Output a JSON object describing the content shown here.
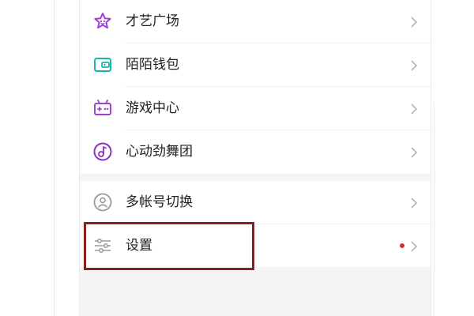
{
  "menu": {
    "group1": [
      {
        "label": "才艺广场",
        "icon": "talent-star-icon"
      },
      {
        "label": "陌陌钱包",
        "icon": "wallet-icon"
      },
      {
        "label": "游戏中心",
        "icon": "gamepad-icon"
      },
      {
        "label": "心动劲舞团",
        "icon": "music-note-icon"
      }
    ],
    "group2": [
      {
        "label": "多帐号切换",
        "icon": "account-switch-icon"
      },
      {
        "label": "设置",
        "icon": "settings-sliders-icon",
        "has_notification_dot": true
      }
    ]
  },
  "colors": {
    "talent_purple": "#9b3fd6",
    "wallet_teal": "#19b5a8",
    "game_purple": "#a040d0",
    "music_purple": "#8a2fc0",
    "gray_icon": "#9a9a9a",
    "notification_dot": "#d0312d",
    "highlight_box": "#8b1e1e"
  }
}
